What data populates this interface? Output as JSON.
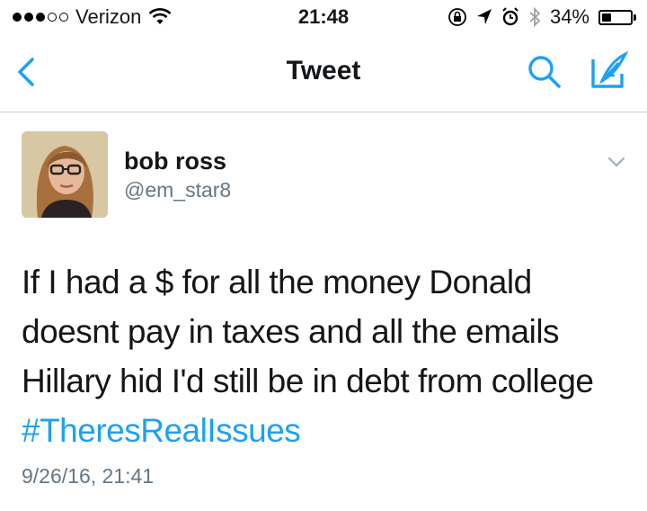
{
  "status_bar": {
    "carrier": "Verizon",
    "signal_bars": 3,
    "signal_max": 5,
    "time": "21:48",
    "battery_percent": "34%",
    "battery_level": 0.34
  },
  "nav": {
    "title": "Tweet",
    "accent_color": "#1da1f2"
  },
  "tweet": {
    "author_name": "bob ross",
    "author_handle": "@em_star8",
    "text_lines": [
      "If I had a $ for all the money Donald",
      "doesnt pay in taxes and all the emails",
      "Hillary hid I'd still be in debt from college"
    ],
    "hashtag": "#TheresRealIssues",
    "timestamp": "9/26/16, 21:41"
  },
  "icons": [
    "back-icon",
    "search-icon",
    "compose-icon",
    "chevron-down-icon",
    "wifi-icon",
    "lock-rotation-icon",
    "location-icon",
    "alarm-icon",
    "bluetooth-icon",
    "battery-icon"
  ]
}
